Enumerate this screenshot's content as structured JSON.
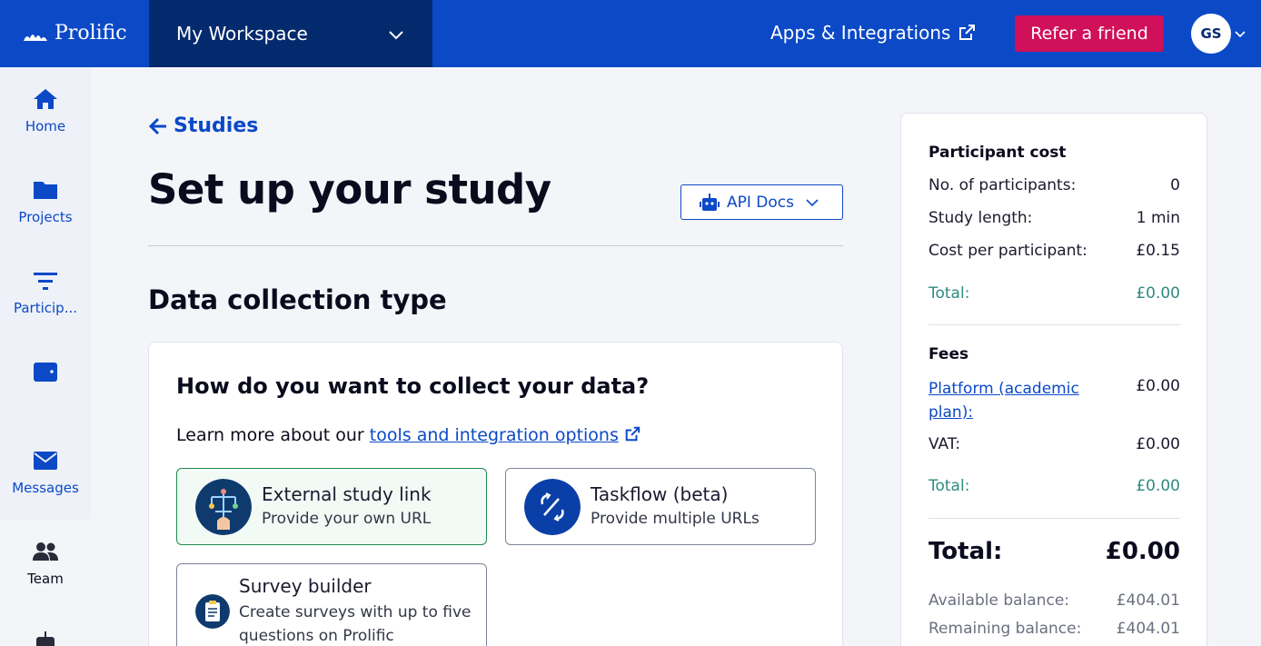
{
  "topbar": {
    "logo_text": "Prolific",
    "workspace": "My Workspace",
    "apps_label": "Apps & Integrations",
    "refer_label": "Refer a friend",
    "avatar_initials": "GS",
    "colors": {
      "bar": "#0b49c7",
      "workspace": "#042a6e",
      "refer": "#d0105a"
    }
  },
  "sidebar": {
    "items": [
      {
        "label": "Home",
        "icon": "home-icon"
      },
      {
        "label": "Projects",
        "icon": "folder-icon"
      },
      {
        "label": "Particip...",
        "icon": "filter-icon"
      },
      {
        "label": "",
        "icon": "wallet-icon"
      },
      {
        "label": "Messages",
        "icon": "envelope-icon"
      },
      {
        "label": "Team",
        "icon": "users-icon"
      }
    ]
  },
  "main": {
    "back_label": "Studies",
    "title": "Set up your study",
    "api_docs_label": "API Docs",
    "section_title": "Data collection type",
    "card": {
      "question": "How do you want to collect your data?",
      "learn_prefix": "Learn more about our ",
      "learn_link": "tools and integration options",
      "options": [
        {
          "title": "External study link",
          "subtitle": "Provide your own URL",
          "selected": true
        },
        {
          "title": "Taskflow (beta)",
          "subtitle": "Provide multiple URLs",
          "selected": false
        },
        {
          "title": "Survey builder",
          "subtitle": "Create surveys with up to five questions on Prolific",
          "selected": false
        }
      ]
    }
  },
  "summary": {
    "participant_cost_heading": "Participant cost",
    "participants_label": "No. of participants:",
    "participants_value": "0",
    "length_label": "Study length:",
    "length_value": "1 min",
    "cpp_label": "Cost per participant:",
    "cpp_value": "£0.15",
    "subtotal_label": "Total:",
    "subtotal_value": "£0.00",
    "fees_heading": "Fees",
    "platform_label": "Platform (academic plan):",
    "platform_value": "£0.00",
    "vat_label": "VAT:",
    "vat_value": "£0.00",
    "fees_total_label": "Total:",
    "fees_total_value": "£0.00",
    "grand_label": "Total:",
    "grand_value": "£0.00",
    "available_label": "Available balance:",
    "available_value": "£404.01",
    "remaining_label": "Remaining balance:",
    "remaining_value": "£404.01"
  }
}
